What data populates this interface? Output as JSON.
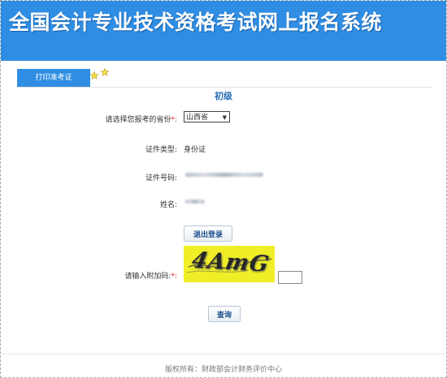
{
  "header": {
    "title": "全国会计专业技术资格考试网上报名系统"
  },
  "tabs": {
    "print_admission": "打印准考证"
  },
  "form": {
    "level": "初级",
    "province_label": "请选择您报考的省份",
    "province_required": "*:",
    "province_value": "山西省",
    "id_type_label": "证件类型:",
    "id_type_value": "身份证",
    "id_number_label": "证件号码:",
    "name_label": "姓名:",
    "logout_button": "退出登录",
    "captcha_label": "请输入附加码:",
    "captcha_required": "*:",
    "captcha_text": "4AmG",
    "captcha_input_value": "",
    "query_button": "查询"
  },
  "footer": {
    "text": "版权所有：财政部会计财务评价中心"
  },
  "colors": {
    "header_blue": "#2f8ee3",
    "captcha_yellow": "#f0ef27",
    "required_red": "#e02020"
  },
  "icons": [
    "star-icon",
    "chevron-down-icon"
  ]
}
